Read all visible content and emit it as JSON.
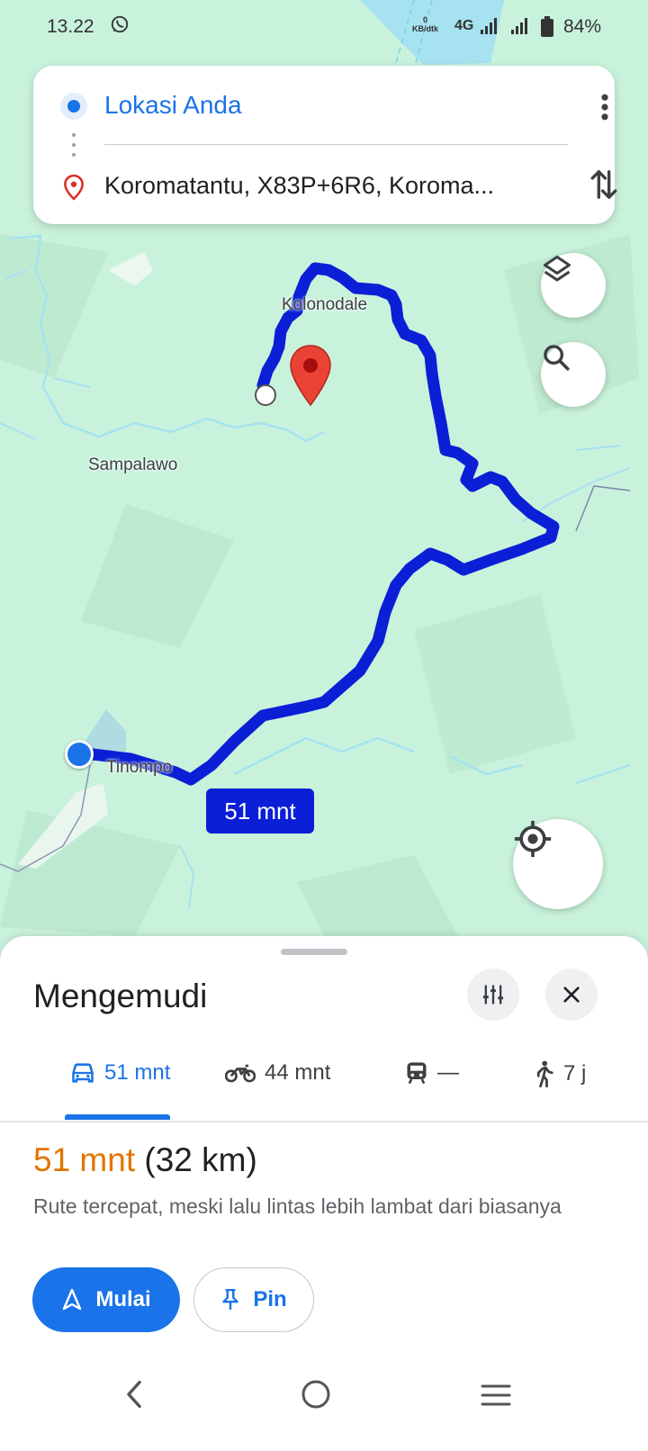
{
  "status_bar": {
    "time": "13.22",
    "net_speed_value": "0",
    "net_speed_unit": "KB/dtk",
    "network": "4G",
    "battery": "84%"
  },
  "route_card": {
    "origin": "Lokasi Anda",
    "destination": "Koromatantu, X83P+6R6, Koroma..."
  },
  "map": {
    "labels": {
      "kolonodale": "Kolonodale",
      "sampalawo": "Sampalawo",
      "tinompo": "Tinompo"
    },
    "eta_badge": "51 mnt",
    "route_color": "#0b1fd6",
    "water_color": "#a6e2f0",
    "land_color": "#c9f2dc"
  },
  "sheet": {
    "title": "Mengemudi",
    "tabs": [
      {
        "icon": "car-icon",
        "label": "51 mnt"
      },
      {
        "icon": "motorcycle-icon",
        "label": "44 mnt"
      },
      {
        "icon": "transit-icon",
        "label": "—"
      },
      {
        "icon": "walk-icon",
        "label": "7 j"
      }
    ],
    "summary_time": "51 mnt",
    "summary_distance": "(32 km)",
    "description": "Rute tercepat, meski lalu lintas lebih lambat dari biasanya",
    "start_label": "Mulai",
    "pin_label": "Pin"
  },
  "colors": {
    "accent": "#1a73e8",
    "eta_orange": "#e37400"
  }
}
